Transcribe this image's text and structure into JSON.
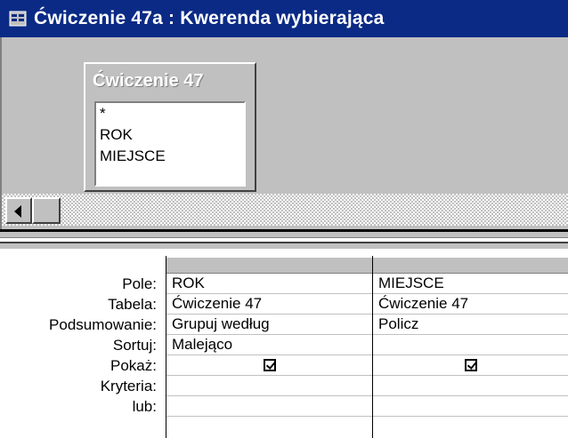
{
  "window": {
    "title": "Ćwiczenie 47a : Kwerenda wybierająca"
  },
  "table": {
    "name": "Ćwiczenie 47",
    "fields": [
      "*",
      "ROK",
      "MIEJSCE"
    ]
  },
  "grid": {
    "row_labels": [
      "Pole:",
      "Tabela:",
      "Podsumowanie:",
      "Sortuj:",
      "Pokaż:",
      "Kryteria:",
      "lub:"
    ],
    "columns": [
      {
        "pole": "ROK",
        "tabela": "Ćwiczenie 47",
        "podsumowanie": "Grupuj według",
        "sortuj": "Malejąco",
        "pokaz": true,
        "kryteria": "",
        "lub": ""
      },
      {
        "pole": "MIEJSCE",
        "tabela": "Ćwiczenie 47",
        "podsumowanie": "Policz",
        "sortuj": "",
        "pokaz": true,
        "kryteria": "",
        "lub": ""
      }
    ]
  },
  "icons": {
    "title": "query-window-icon",
    "scroll_left": "scroll-left-arrow-icon",
    "checkbox": "checkbox-checked-icon"
  },
  "colors": {
    "titlebar": "#0a2a85",
    "pane": "#c0c0c0"
  }
}
